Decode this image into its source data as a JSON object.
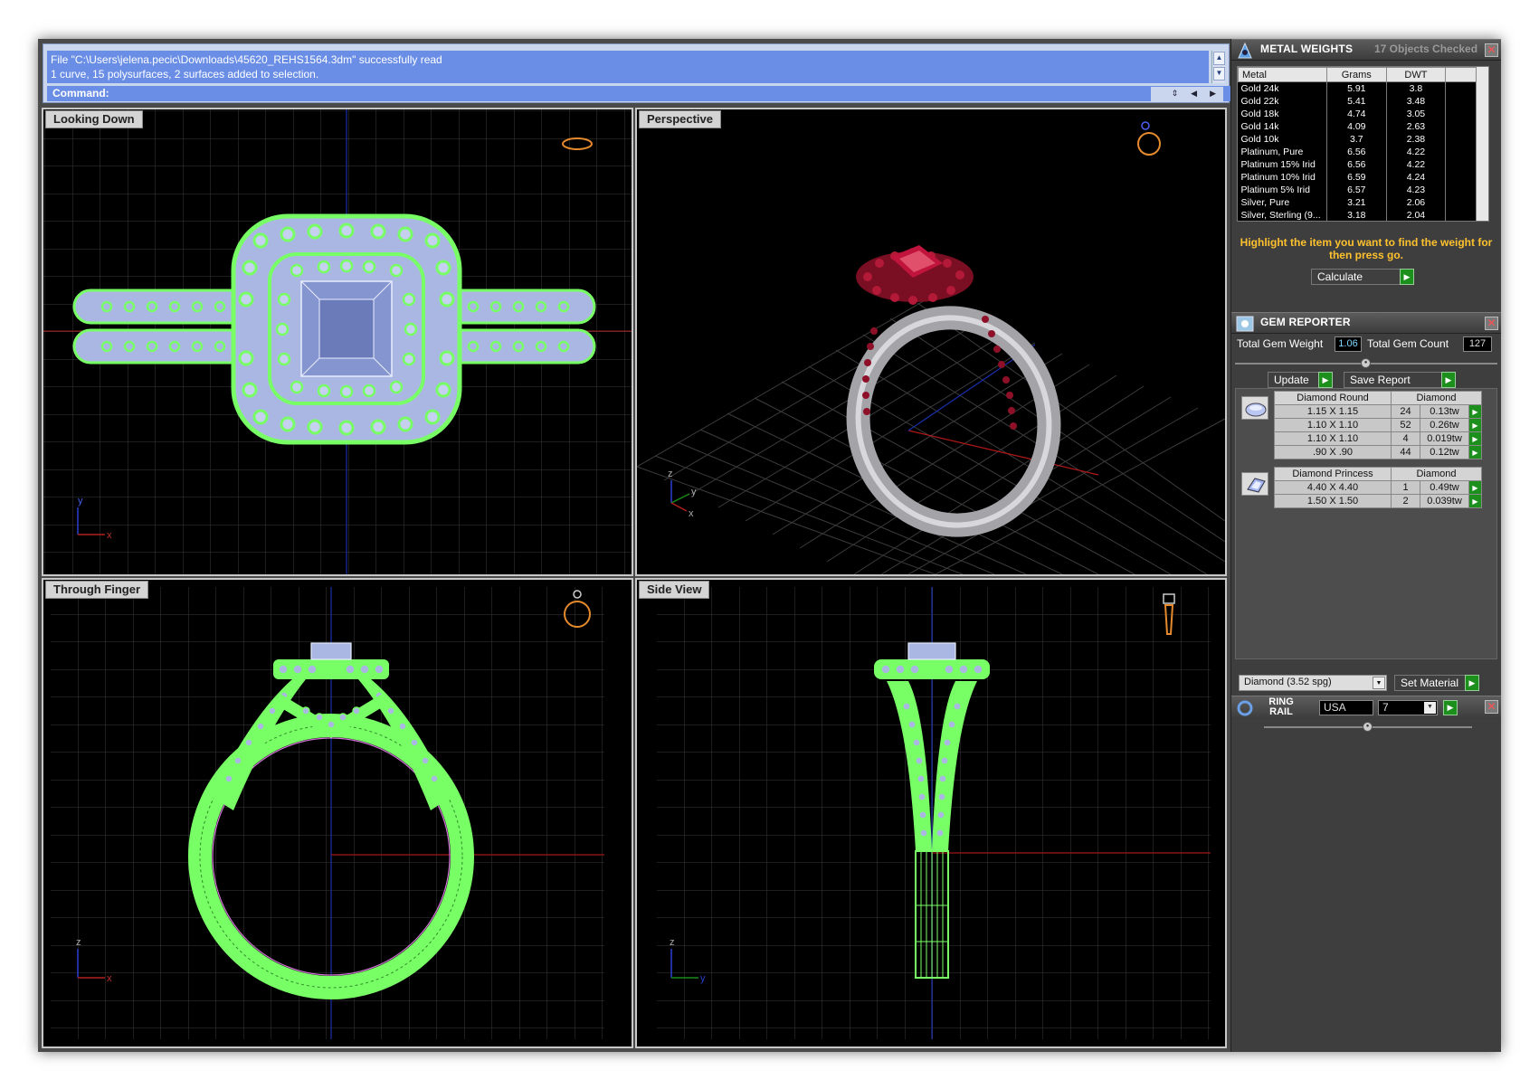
{
  "command": {
    "history": [
      "File \"C:\\Users\\jelena.pecic\\Downloads\\45620_REHS1564.3dm\" successfully read",
      "1 curve, 15 polysurfaces, 2 surfaces added to selection."
    ],
    "prompt_label": "Command:"
  },
  "viewports": {
    "top": "Looking Down",
    "perspective": "Perspective",
    "front": "Through Finger",
    "right": "Side View"
  },
  "axes": {
    "x": "x",
    "y": "y",
    "z": "z"
  },
  "metal_weights": {
    "title": "METAL WEIGHTS",
    "objects_checked": "17 Objects Checked",
    "columns": [
      "Metal",
      "Grams",
      "DWT"
    ],
    "rows": [
      [
        "Gold 24k",
        "5.91",
        "3.8"
      ],
      [
        "Gold 22k",
        "5.41",
        "3.48"
      ],
      [
        "Gold 18k",
        "4.74",
        "3.05"
      ],
      [
        "Gold 14k",
        "4.09",
        "2.63"
      ],
      [
        "Gold 10k",
        "3.7",
        "2.38"
      ],
      [
        "Platinum, Pure",
        "6.56",
        "4.22"
      ],
      [
        "Platinum 15% Irid",
        "6.56",
        "4.22"
      ],
      [
        "Platinum 10% Irid",
        "6.59",
        "4.24"
      ],
      [
        "Platinum 5% Irid",
        "6.57",
        "4.23"
      ],
      [
        "Silver, Pure",
        "3.21",
        "2.06"
      ],
      [
        "Silver, Sterling (9...",
        "3.18",
        "2.04"
      ]
    ],
    "hint": "Highlight the item you want to find the weight for then press go.",
    "calculate_label": "Calculate"
  },
  "gem_reporter": {
    "title": "GEM REPORTER",
    "total_weight_label": "Total Gem Weight",
    "total_weight": "1.06",
    "total_count_label": "Total Gem Count",
    "total_count": "127",
    "update_label": "Update",
    "save_label": "Save Report",
    "groups": [
      {
        "shape": "Diamond Round",
        "material": "Diamond",
        "rows": [
          [
            "1.15 X 1.15",
            "24",
            "0.13tw"
          ],
          [
            "1.10 X 1.10",
            "52",
            "0.26tw"
          ],
          [
            "1.10 X 1.10",
            "4",
            "0.019tw"
          ],
          [
            ".90 X .90",
            "44",
            "0.12tw"
          ]
        ]
      },
      {
        "shape": "Diamond Princess",
        "material": "Diamond",
        "rows": [
          [
            "4.40 X 4.40",
            "1",
            "0.49tw"
          ],
          [
            "1.50 X 1.50",
            "2",
            "0.039tw"
          ]
        ]
      }
    ],
    "material_select": "Diamond    (3.52 spg)",
    "set_material_label": "Set Material"
  },
  "ring_rail": {
    "title": "RING RAIL",
    "system": "USA",
    "size": "7"
  },
  "colors": {
    "wire": "#7dff6e",
    "gem_fill": "#aebce8",
    "ruby": "#9e1030",
    "metal": "#b6b6ba",
    "accent_green": "#1d8f1d",
    "hint_yellow": "#ffc22e"
  }
}
